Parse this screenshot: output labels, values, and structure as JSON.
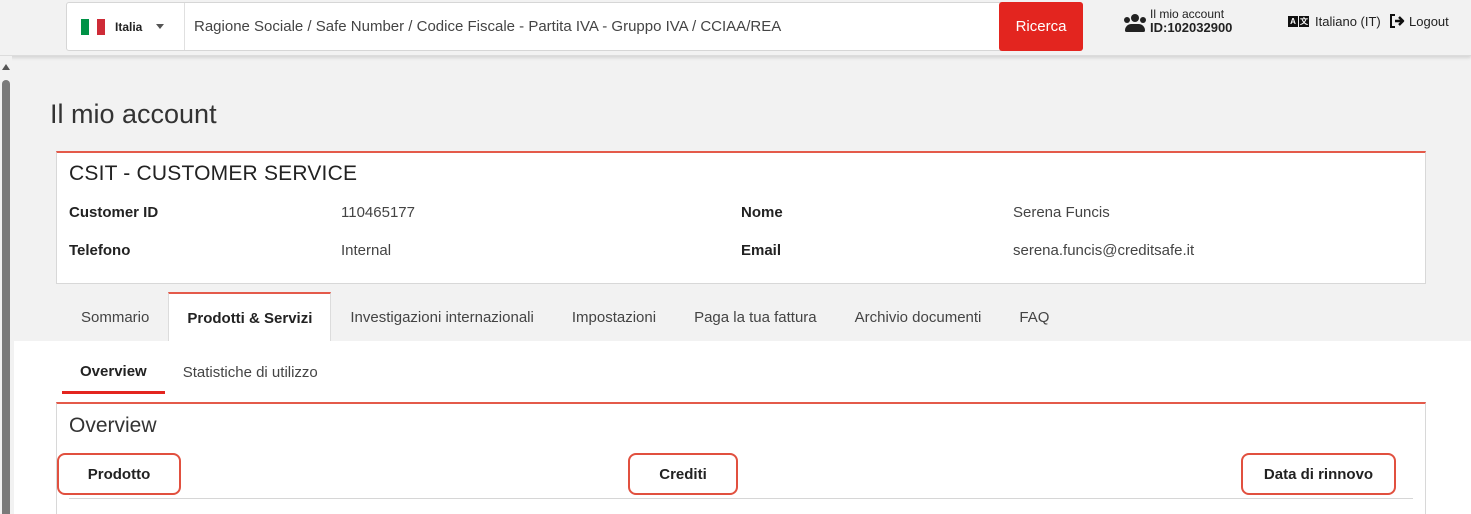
{
  "header": {
    "country": "Italia",
    "search_placeholder": "Ragione Sociale / Safe Number / Codice Fiscale - Partita IVA - Gruppo IVA / CCIAA/REA",
    "search_button": "Ricerca",
    "account_label": "Il mio account",
    "account_id": "ID:102032900",
    "language": "Italiano (IT)",
    "logout": "Logout"
  },
  "page": {
    "title": "Il mio account"
  },
  "customer": {
    "name": "CSIT - CUSTOMER SERVICE",
    "customer_id_label": "Customer ID",
    "customer_id": "110465177",
    "nome_label": "Nome",
    "nome": "Serena Funcis",
    "telefono_label": "Telefono",
    "telefono": "Internal",
    "email_label": "Email",
    "email": "serena.funcis@creditsafe.it"
  },
  "tabs": [
    {
      "label": "Sommario"
    },
    {
      "label": "Prodotti & Servizi",
      "active": true
    },
    {
      "label": "Investigazioni internazionali"
    },
    {
      "label": "Impostazioni"
    },
    {
      "label": "Paga la tua fattura"
    },
    {
      "label": "Archivio documenti"
    },
    {
      "label": "FAQ"
    }
  ],
  "subtabs": [
    {
      "label": "Overview",
      "active": true
    },
    {
      "label": "Statistiche di utilizzo"
    }
  ],
  "overview": {
    "title": "Overview",
    "columns": [
      "Prodotto",
      "Crediti",
      "Data di rinnovo"
    ]
  },
  "colors": {
    "accent": "#e3251f",
    "highlight_border": "#e1503f",
    "flag": [
      "#009246",
      "#ffffff",
      "#ce2b37"
    ]
  },
  "icons": {
    "country_flag": "italy-flag-icon",
    "account": "users-icon",
    "language": "language-icon",
    "logout": "logout-arrow-icon"
  }
}
